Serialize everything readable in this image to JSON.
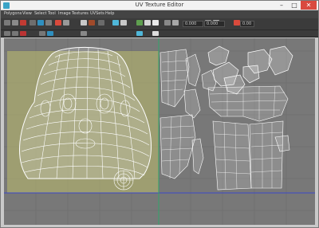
{
  "window": {
    "title": "UV Texture Editor",
    "minimize": "–",
    "maximize": "□",
    "close": "✕"
  },
  "menubar": {
    "items": [
      {
        "label": "Polygons"
      },
      {
        "label": "View"
      },
      {
        "label": "Select"
      },
      {
        "label": "Tool"
      },
      {
        "label": "Image"
      },
      {
        "label": "Textures"
      },
      {
        "label": "UVSets"
      },
      {
        "label": "Help"
      }
    ]
  },
  "toolbar": {
    "field_u": "0.000",
    "field_v": "0.000",
    "field_gamma": "0.00",
    "accent_color": "#d94a3c",
    "icons": [
      "move-icon",
      "rotate-icon",
      "scale-icon",
      "flip-icon",
      "cut-icon",
      "sew-icon",
      "unfold-icon",
      "layout-icon",
      "grid-icon",
      "shade-icon",
      "snapshot-icon",
      "image-icon"
    ]
  },
  "viewport": {
    "background": "#787878",
    "grid_color": "#6a6a6a",
    "highlight_region_color": "#c8c878",
    "uv_color": "#ffffff",
    "axis_u_color": "#3b47c9",
    "axis_v_color": "#2fa36a"
  }
}
